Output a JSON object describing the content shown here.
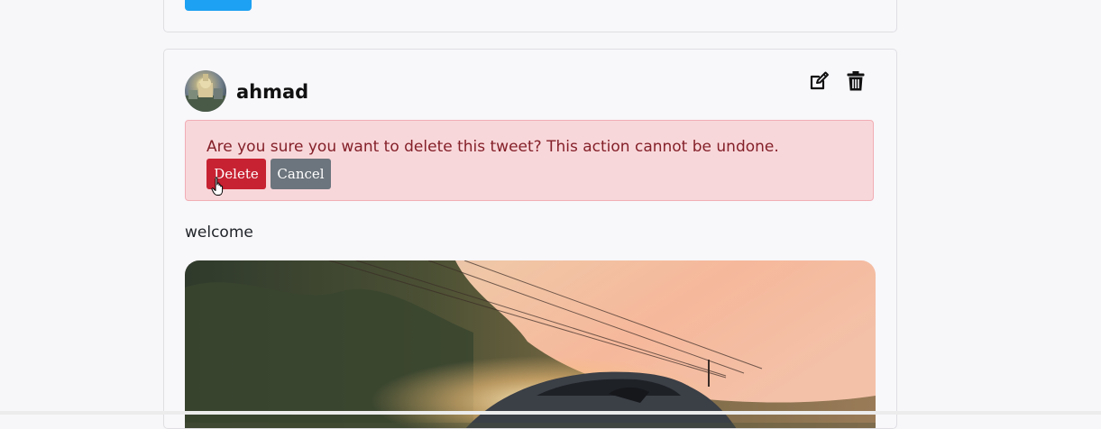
{
  "post": {
    "username": "ahmad",
    "text": "welcome"
  },
  "confirm": {
    "message": "Are you sure you want to delete this tweet? This action cannot be undone.",
    "delete_label": "Delete",
    "cancel_label": "Cancel"
  },
  "icons": {
    "edit": "edit-icon",
    "delete": "trash-icon"
  },
  "colors": {
    "accent": "#1da1f2",
    "danger": "#c72232",
    "alert_bg": "#f8d7da",
    "alert_text": "#842029",
    "secondary": "#6c757d"
  }
}
